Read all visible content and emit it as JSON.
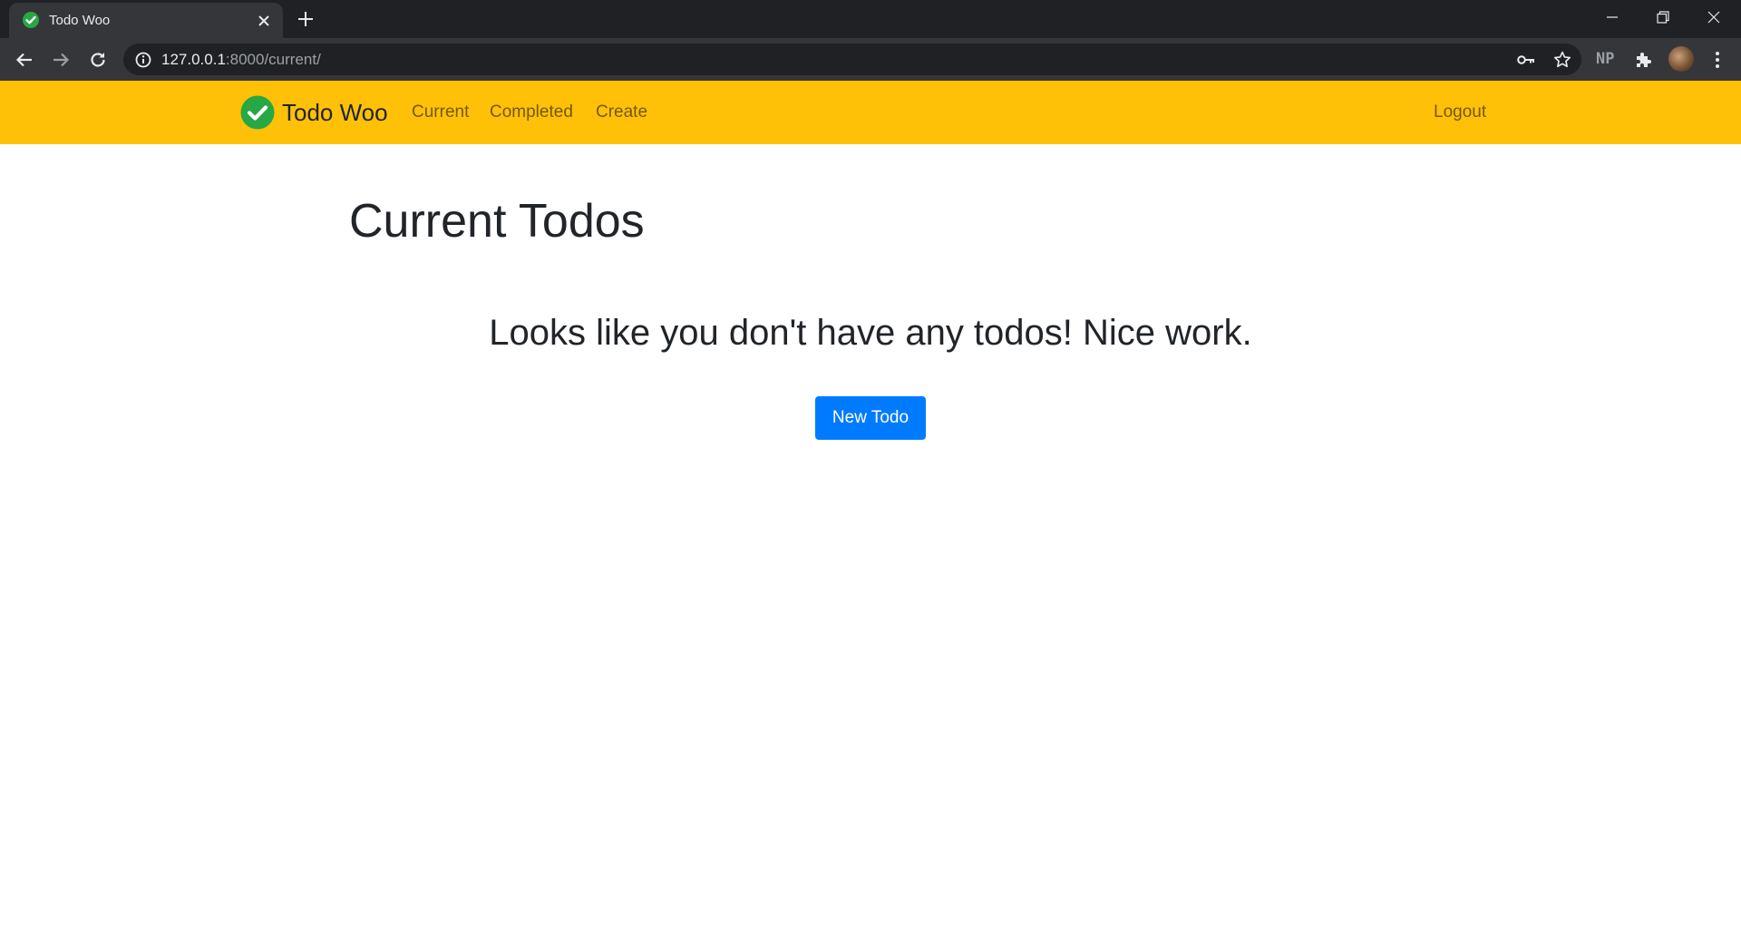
{
  "browser": {
    "tab_title": "Todo Woo",
    "url_host": "127.0.0.1",
    "url_rest": ":8000/current/",
    "extension_label": "NP",
    "colors": {
      "tabstrip": "#202124",
      "toolbar": "#35363a",
      "omnibox": "#202124"
    }
  },
  "navbar": {
    "brand": "Todo Woo",
    "links": {
      "current": "Current",
      "completed": "Completed",
      "create": "Create",
      "logout": "Logout"
    },
    "colors": {
      "background": "#ffc107",
      "logo": "#28a745"
    }
  },
  "main": {
    "title": "Current Todos",
    "empty_message": "Looks like you don't have any todos! Nice work.",
    "new_todo_button": "New Todo",
    "colors": {
      "button": "#007bff"
    }
  }
}
